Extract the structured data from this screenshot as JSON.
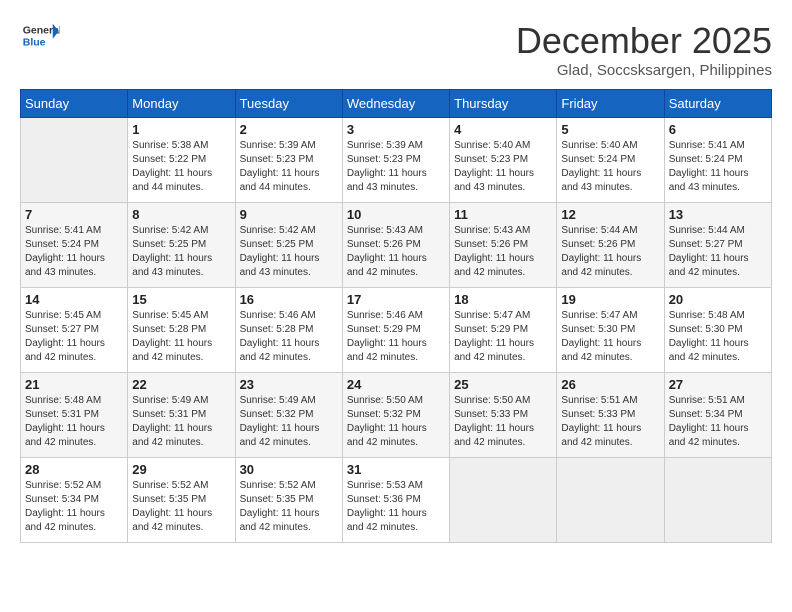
{
  "header": {
    "logo_line1": "General",
    "logo_line2": "Blue",
    "title": "December 2025",
    "subtitle": "Glad, Soccsksargen, Philippines"
  },
  "days_of_week": [
    "Sunday",
    "Monday",
    "Tuesday",
    "Wednesday",
    "Thursday",
    "Friday",
    "Saturday"
  ],
  "weeks": [
    [
      {
        "day": "",
        "info": ""
      },
      {
        "day": "1",
        "info": "Sunrise: 5:38 AM\nSunset: 5:22 PM\nDaylight: 11 hours\nand 44 minutes."
      },
      {
        "day": "2",
        "info": "Sunrise: 5:39 AM\nSunset: 5:23 PM\nDaylight: 11 hours\nand 44 minutes."
      },
      {
        "day": "3",
        "info": "Sunrise: 5:39 AM\nSunset: 5:23 PM\nDaylight: 11 hours\nand 43 minutes."
      },
      {
        "day": "4",
        "info": "Sunrise: 5:40 AM\nSunset: 5:23 PM\nDaylight: 11 hours\nand 43 minutes."
      },
      {
        "day": "5",
        "info": "Sunrise: 5:40 AM\nSunset: 5:24 PM\nDaylight: 11 hours\nand 43 minutes."
      },
      {
        "day": "6",
        "info": "Sunrise: 5:41 AM\nSunset: 5:24 PM\nDaylight: 11 hours\nand 43 minutes."
      }
    ],
    [
      {
        "day": "7",
        "info": "Sunrise: 5:41 AM\nSunset: 5:24 PM\nDaylight: 11 hours\nand 43 minutes."
      },
      {
        "day": "8",
        "info": "Sunrise: 5:42 AM\nSunset: 5:25 PM\nDaylight: 11 hours\nand 43 minutes."
      },
      {
        "day": "9",
        "info": "Sunrise: 5:42 AM\nSunset: 5:25 PM\nDaylight: 11 hours\nand 43 minutes."
      },
      {
        "day": "10",
        "info": "Sunrise: 5:43 AM\nSunset: 5:26 PM\nDaylight: 11 hours\nand 42 minutes."
      },
      {
        "day": "11",
        "info": "Sunrise: 5:43 AM\nSunset: 5:26 PM\nDaylight: 11 hours\nand 42 minutes."
      },
      {
        "day": "12",
        "info": "Sunrise: 5:44 AM\nSunset: 5:26 PM\nDaylight: 11 hours\nand 42 minutes."
      },
      {
        "day": "13",
        "info": "Sunrise: 5:44 AM\nSunset: 5:27 PM\nDaylight: 11 hours\nand 42 minutes."
      }
    ],
    [
      {
        "day": "14",
        "info": "Sunrise: 5:45 AM\nSunset: 5:27 PM\nDaylight: 11 hours\nand 42 minutes."
      },
      {
        "day": "15",
        "info": "Sunrise: 5:45 AM\nSunset: 5:28 PM\nDaylight: 11 hours\nand 42 minutes."
      },
      {
        "day": "16",
        "info": "Sunrise: 5:46 AM\nSunset: 5:28 PM\nDaylight: 11 hours\nand 42 minutes."
      },
      {
        "day": "17",
        "info": "Sunrise: 5:46 AM\nSunset: 5:29 PM\nDaylight: 11 hours\nand 42 minutes."
      },
      {
        "day": "18",
        "info": "Sunrise: 5:47 AM\nSunset: 5:29 PM\nDaylight: 11 hours\nand 42 minutes."
      },
      {
        "day": "19",
        "info": "Sunrise: 5:47 AM\nSunset: 5:30 PM\nDaylight: 11 hours\nand 42 minutes."
      },
      {
        "day": "20",
        "info": "Sunrise: 5:48 AM\nSunset: 5:30 PM\nDaylight: 11 hours\nand 42 minutes."
      }
    ],
    [
      {
        "day": "21",
        "info": "Sunrise: 5:48 AM\nSunset: 5:31 PM\nDaylight: 11 hours\nand 42 minutes."
      },
      {
        "day": "22",
        "info": "Sunrise: 5:49 AM\nSunset: 5:31 PM\nDaylight: 11 hours\nand 42 minutes."
      },
      {
        "day": "23",
        "info": "Sunrise: 5:49 AM\nSunset: 5:32 PM\nDaylight: 11 hours\nand 42 minutes."
      },
      {
        "day": "24",
        "info": "Sunrise: 5:50 AM\nSunset: 5:32 PM\nDaylight: 11 hours\nand 42 minutes."
      },
      {
        "day": "25",
        "info": "Sunrise: 5:50 AM\nSunset: 5:33 PM\nDaylight: 11 hours\nand 42 minutes."
      },
      {
        "day": "26",
        "info": "Sunrise: 5:51 AM\nSunset: 5:33 PM\nDaylight: 11 hours\nand 42 minutes."
      },
      {
        "day": "27",
        "info": "Sunrise: 5:51 AM\nSunset: 5:34 PM\nDaylight: 11 hours\nand 42 minutes."
      }
    ],
    [
      {
        "day": "28",
        "info": "Sunrise: 5:52 AM\nSunset: 5:34 PM\nDaylight: 11 hours\nand 42 minutes."
      },
      {
        "day": "29",
        "info": "Sunrise: 5:52 AM\nSunset: 5:35 PM\nDaylight: 11 hours\nand 42 minutes."
      },
      {
        "day": "30",
        "info": "Sunrise: 5:52 AM\nSunset: 5:35 PM\nDaylight: 11 hours\nand 42 minutes."
      },
      {
        "day": "31",
        "info": "Sunrise: 5:53 AM\nSunset: 5:36 PM\nDaylight: 11 hours\nand 42 minutes."
      },
      {
        "day": "",
        "info": ""
      },
      {
        "day": "",
        "info": ""
      },
      {
        "day": "",
        "info": ""
      }
    ]
  ]
}
